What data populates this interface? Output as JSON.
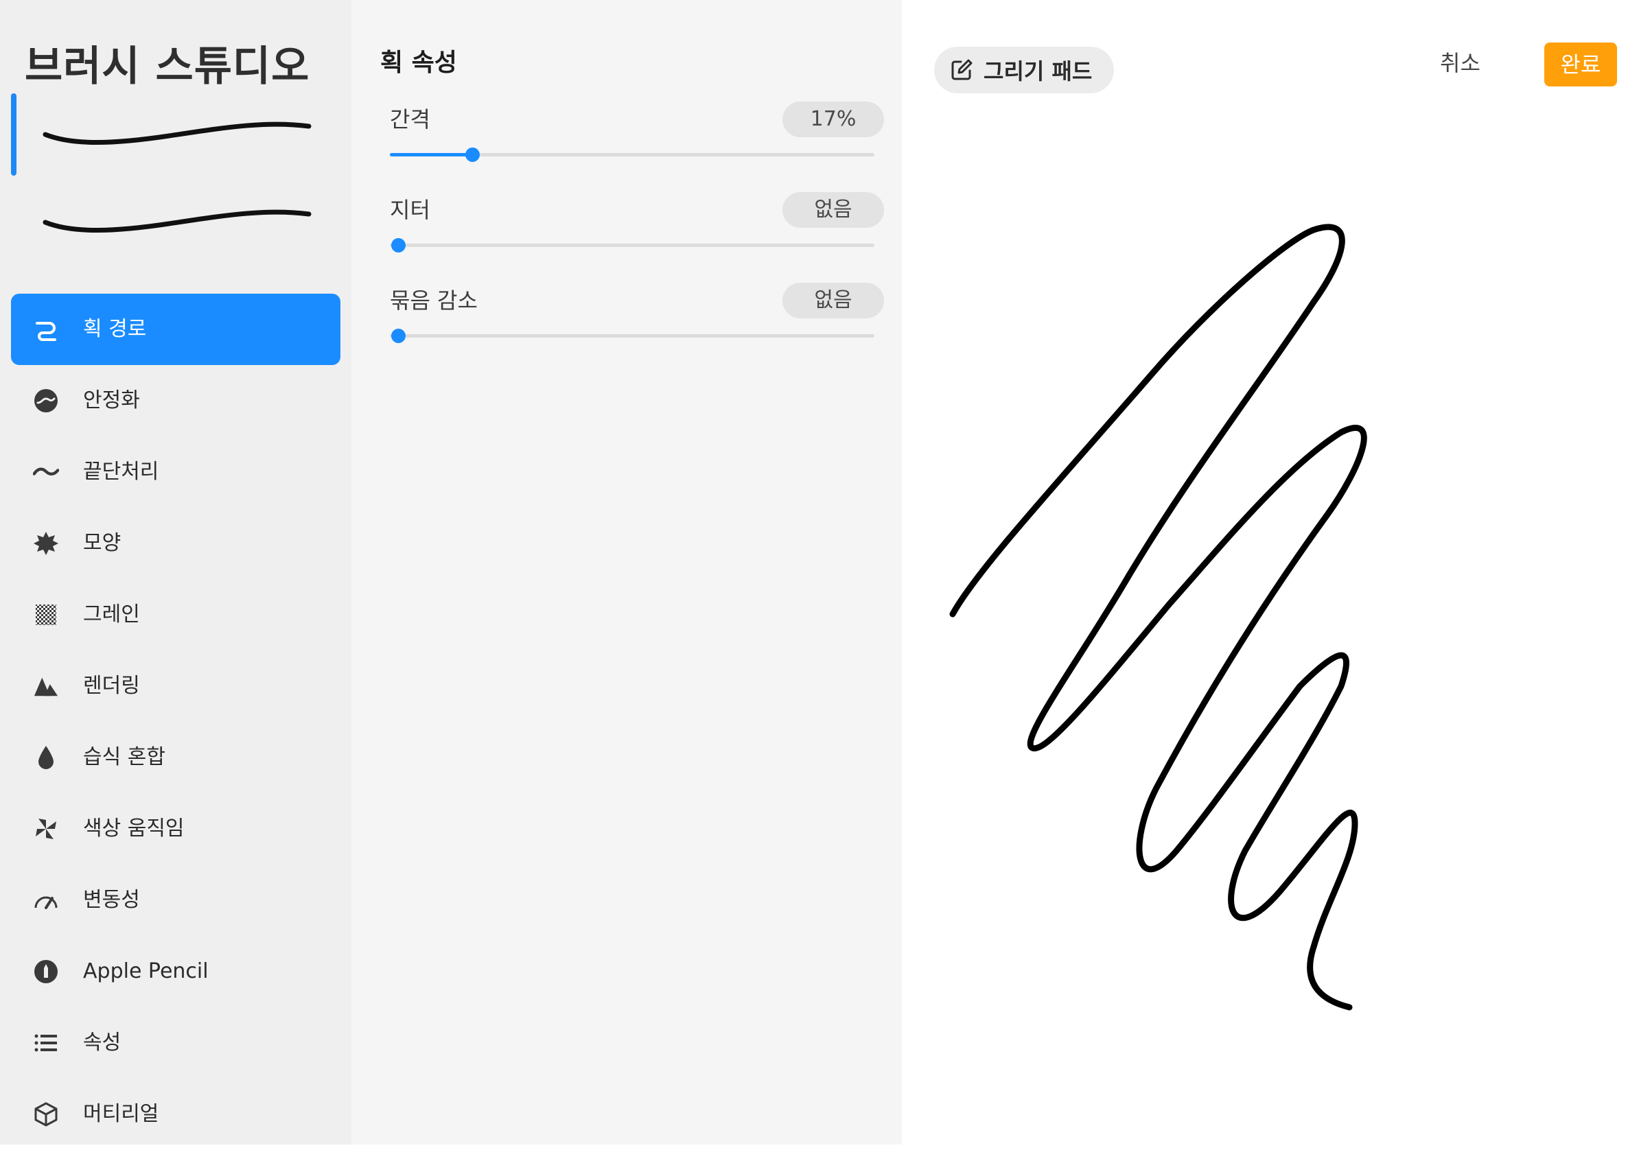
{
  "sidebar": {
    "title": "브러시 스튜디오",
    "items": [
      {
        "label": "획 경로",
        "icon": "stroke-path-icon",
        "active": true
      },
      {
        "label": "안정화",
        "icon": "stabilization-icon"
      },
      {
        "label": "끝단처리",
        "icon": "taper-icon"
      },
      {
        "label": "모양",
        "icon": "shape-icon"
      },
      {
        "label": "그레인",
        "icon": "grain-icon"
      },
      {
        "label": "렌더링",
        "icon": "rendering-icon"
      },
      {
        "label": "습식 혼합",
        "icon": "wet-mix-icon"
      },
      {
        "label": "색상 움직임",
        "icon": "color-dynamics-icon"
      },
      {
        "label": "변동성",
        "icon": "dynamics-icon"
      },
      {
        "label": "Apple Pencil",
        "icon": "apple-pencil-icon"
      },
      {
        "label": "속성",
        "icon": "properties-icon"
      },
      {
        "label": "머티리얼",
        "icon": "materials-icon"
      }
    ]
  },
  "panel": {
    "title": "획 속성",
    "sliders": [
      {
        "label": "간격",
        "value": "17%",
        "fraction": 0.17
      },
      {
        "label": "지터",
        "value": "없음",
        "fraction": 0
      },
      {
        "label": "묶음 감소",
        "value": "없음",
        "fraction": 0
      }
    ]
  },
  "pad": {
    "badge": "그리기 패드",
    "cancel": "취소",
    "done": "완료"
  },
  "colors": {
    "accent": "#1a8cff",
    "done": "#ff9f0a",
    "sidebar_bg": "#efefef",
    "panel_bg": "#f5f5f5"
  }
}
